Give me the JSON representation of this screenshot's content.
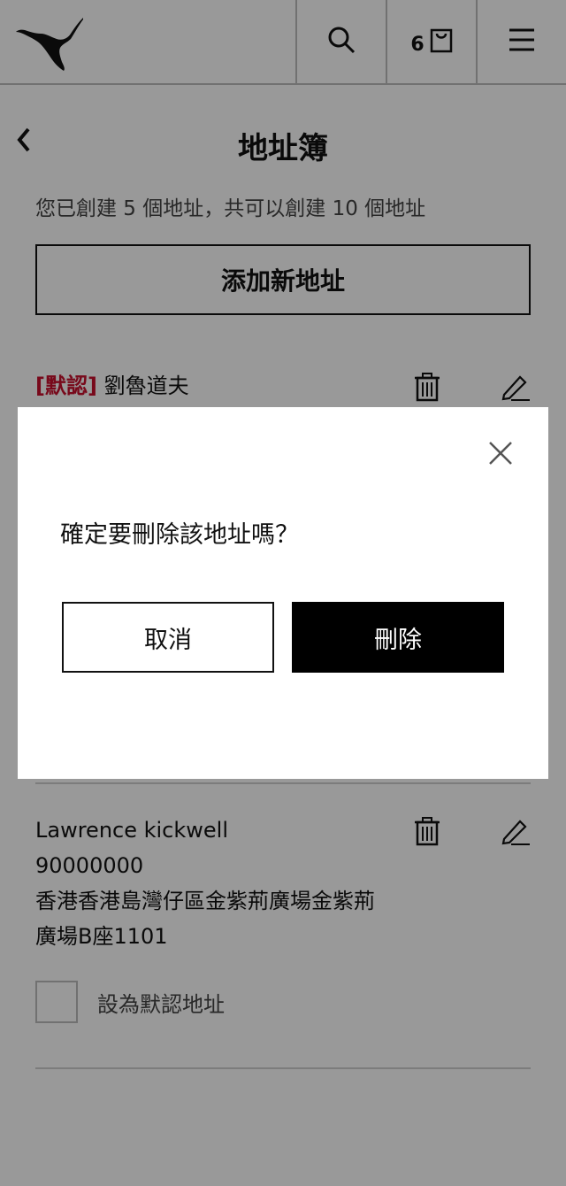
{
  "header": {
    "logo_icon": "puma-logo-icon",
    "search_icon": "search-icon",
    "cart_icon": "shopping-bag-icon",
    "cart_count": "6",
    "menu_icon": "hamburger-menu-icon"
  },
  "page": {
    "title": "地址簿",
    "back_icon": "chevron-left-icon",
    "subtitle": "您已創建 5 個地址，共可以創建 10 個地址",
    "add_button": "添加新地址"
  },
  "addresses": [
    {
      "default_tag": "[默認]",
      "name": "劉魯道夫"
    },
    {
      "name": "Lawrence kickwell",
      "phone": "90000000",
      "address_line1": "香港香港島灣仔區金紫荊廣場金紫荊",
      "address_line2": "廣場B座1101",
      "set_default_label": "設為默認地址"
    }
  ],
  "modal": {
    "message": "確定要刪除該地址嗎？",
    "cancel_label": "取消",
    "delete_label": "刪除",
    "close_icon": "close-icon"
  },
  "colors": {
    "default_tag": "#c8102e",
    "primary_button": "#000000",
    "overlay": "rgba(0,0,0,0.4)"
  }
}
